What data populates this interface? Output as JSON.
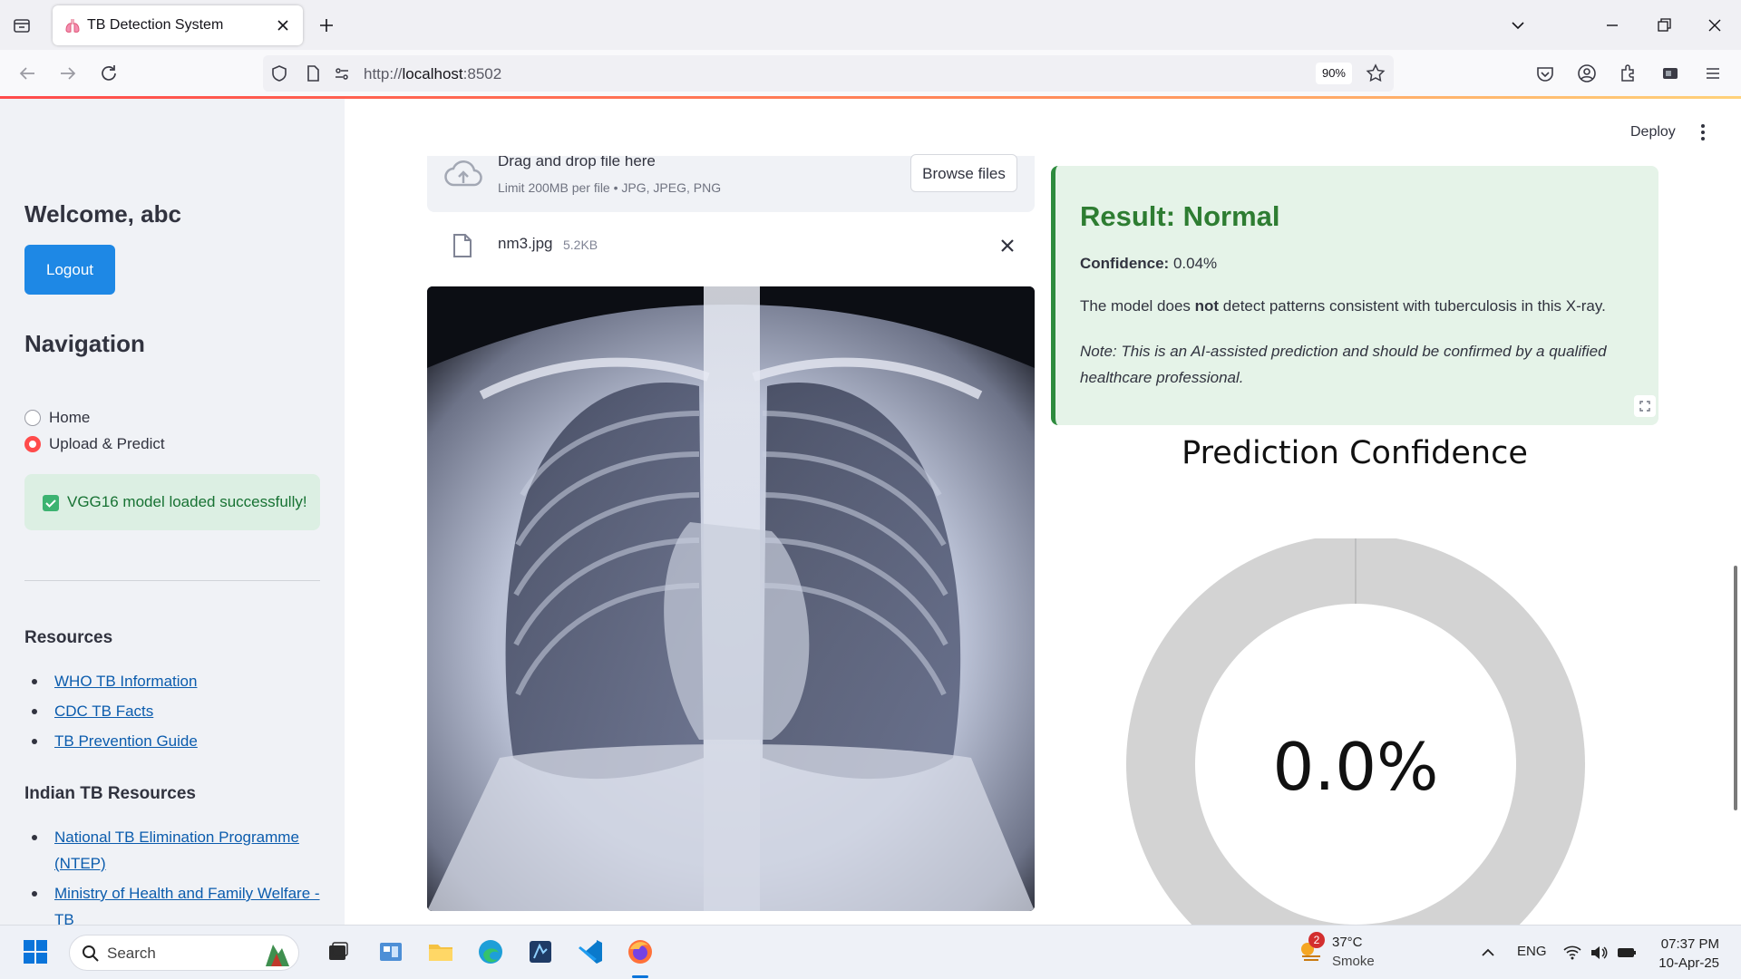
{
  "browser": {
    "tab_title": "TB Detection System",
    "url_prefix": "http://",
    "url_host": "localhost",
    "url_port": ":8502",
    "zoom": "90%"
  },
  "sidebar": {
    "welcome": "Welcome, abc",
    "logout_label": "Logout",
    "nav_title": "Navigation",
    "nav_options": [
      {
        "label": "Home",
        "selected": false
      },
      {
        "label": "Upload & Predict",
        "selected": true
      }
    ],
    "success_msg": "VGG16 model loaded successfully!",
    "resources_title": "Resources",
    "resources": [
      "WHO TB Information",
      "CDC TB Facts",
      "TB Prevention Guide"
    ],
    "indian_title": "Indian TB Resources",
    "indian_resources": [
      "National TB Elimination Programme (NTEP)",
      "Ministry of Health and Family Welfare - TB"
    ]
  },
  "header": {
    "deploy_label": "Deploy"
  },
  "uploader": {
    "drag_text": "Drag and drop file here",
    "limit_text": "Limit 200MB per file • JPG, JPEG, PNG",
    "browse_label": "Browse files",
    "file_name": "nm3.jpg",
    "file_size": "5.2KB"
  },
  "result": {
    "heading": "Result: Normal",
    "confidence_label": "Confidence:",
    "confidence_value": "0.04%",
    "desc_pre": "The model does ",
    "desc_bold": "not",
    "desc_post": " detect patterns consistent with tuberculosis in this X-ray.",
    "note": "Note: This is an AI-assisted prediction and should be confirmed by a qualified healthcare professional.",
    "color": "#2e7d32"
  },
  "chart_data": {
    "type": "pie",
    "title": "Prediction Confidence",
    "center_label": "0.0%",
    "values": [
      0.04,
      99.96
    ],
    "colors": [
      "#1f77b4",
      "#d3d3d3"
    ]
  },
  "taskbar": {
    "search_placeholder": "Search",
    "weather_temp": "37°C",
    "weather_desc": "Smoke",
    "weather_badge": "2",
    "language": "ENG",
    "time": "07:37 PM",
    "date": "10-Apr-25"
  }
}
